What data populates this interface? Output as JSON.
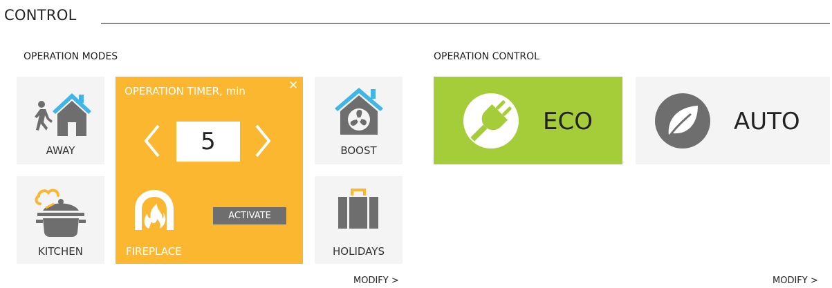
{
  "page": {
    "title": "CONTROL"
  },
  "operation_modes": {
    "heading": "OPERATION MODES",
    "away_label": "AWAY",
    "kitchen_label": "KITCHEN",
    "boost_label": "BOOST",
    "holidays_label": "HOLIDAYS",
    "timer": {
      "title": "OPERATION TIMER, min",
      "close_icon": "close-icon",
      "value": "5",
      "activate_label": "ACTIVATE",
      "mode_label": "FIREPLACE"
    },
    "modify_label": "MODIFY >"
  },
  "operation_control": {
    "heading": "OPERATION CONTROL",
    "eco_label": "ECO",
    "auto_label": "AUTO",
    "modify_label": "MODIFY >"
  },
  "colors": {
    "timer_bg": "#fbb72f",
    "eco_bg": "#a4cd39",
    "tile_bg": "#f4f4f4",
    "roof_blue": "#3fb6e6",
    "icon_gray": "#6e6e6e"
  }
}
